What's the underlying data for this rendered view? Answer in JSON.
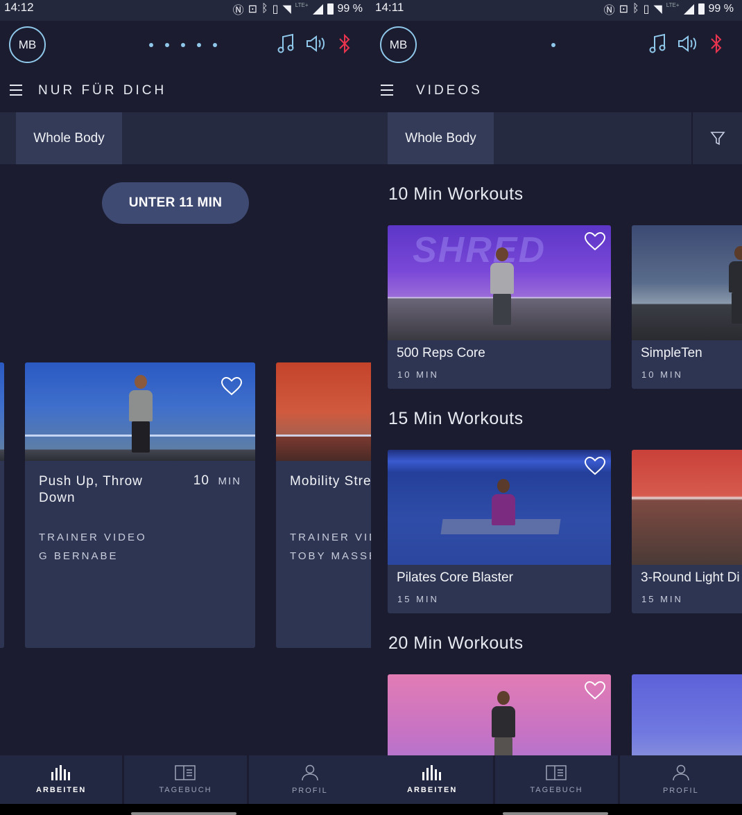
{
  "left": {
    "status": {
      "time": "14:12",
      "battery": "99 %",
      "lte": "LTE+"
    },
    "avatar": "MB",
    "title": "NUR FÜR DICH",
    "filter_tab": "Whole Body",
    "pill": "UNTER 11 MIN",
    "card_main": {
      "title": "Push Up, Throw Down",
      "duration_num": "10",
      "duration_unit": "MIN",
      "sub1": "TRAINER VIDEO",
      "sub2": "G BERNABE"
    },
    "card_next": {
      "title": "Mobility Stre",
      "sub1": "TRAINER VIDE",
      "sub2": "TOBY MASSE"
    },
    "nav": [
      "ARBEITEN",
      "TAGEBUCH",
      "PROFIL"
    ]
  },
  "right": {
    "status": {
      "time": "14:11",
      "battery": "99 %",
      "lte": "LTE+"
    },
    "avatar": "MB",
    "title": "VIDEOS",
    "filter_tab": "Whole Body",
    "sections": [
      {
        "title": "10 Min Workouts",
        "cards": [
          {
            "title": "500 Reps Core",
            "duration": "10 MIN",
            "thumb_text": "SHRED"
          },
          {
            "title": "SimpleTen",
            "duration": "10 MIN"
          }
        ]
      },
      {
        "title": "15 Min Workouts",
        "cards": [
          {
            "title": "Pilates Core Blaster",
            "duration": "15 MIN"
          },
          {
            "title": "3-Round Light Di",
            "duration": "15 MIN"
          }
        ]
      },
      {
        "title": "20 Min Workouts",
        "cards": [
          {
            "title": "",
            "duration": ""
          },
          {
            "title": "",
            "duration": ""
          }
        ]
      }
    ],
    "nav": [
      "ARBEITEN",
      "TAGEBUCH",
      "PROFIL"
    ]
  },
  "colors": {
    "accent": "#8fc8ea",
    "bluetooth": "#e8344e",
    "card": "#2d3552",
    "background": "#1b1c2f",
    "pill": "#3f4a72"
  }
}
